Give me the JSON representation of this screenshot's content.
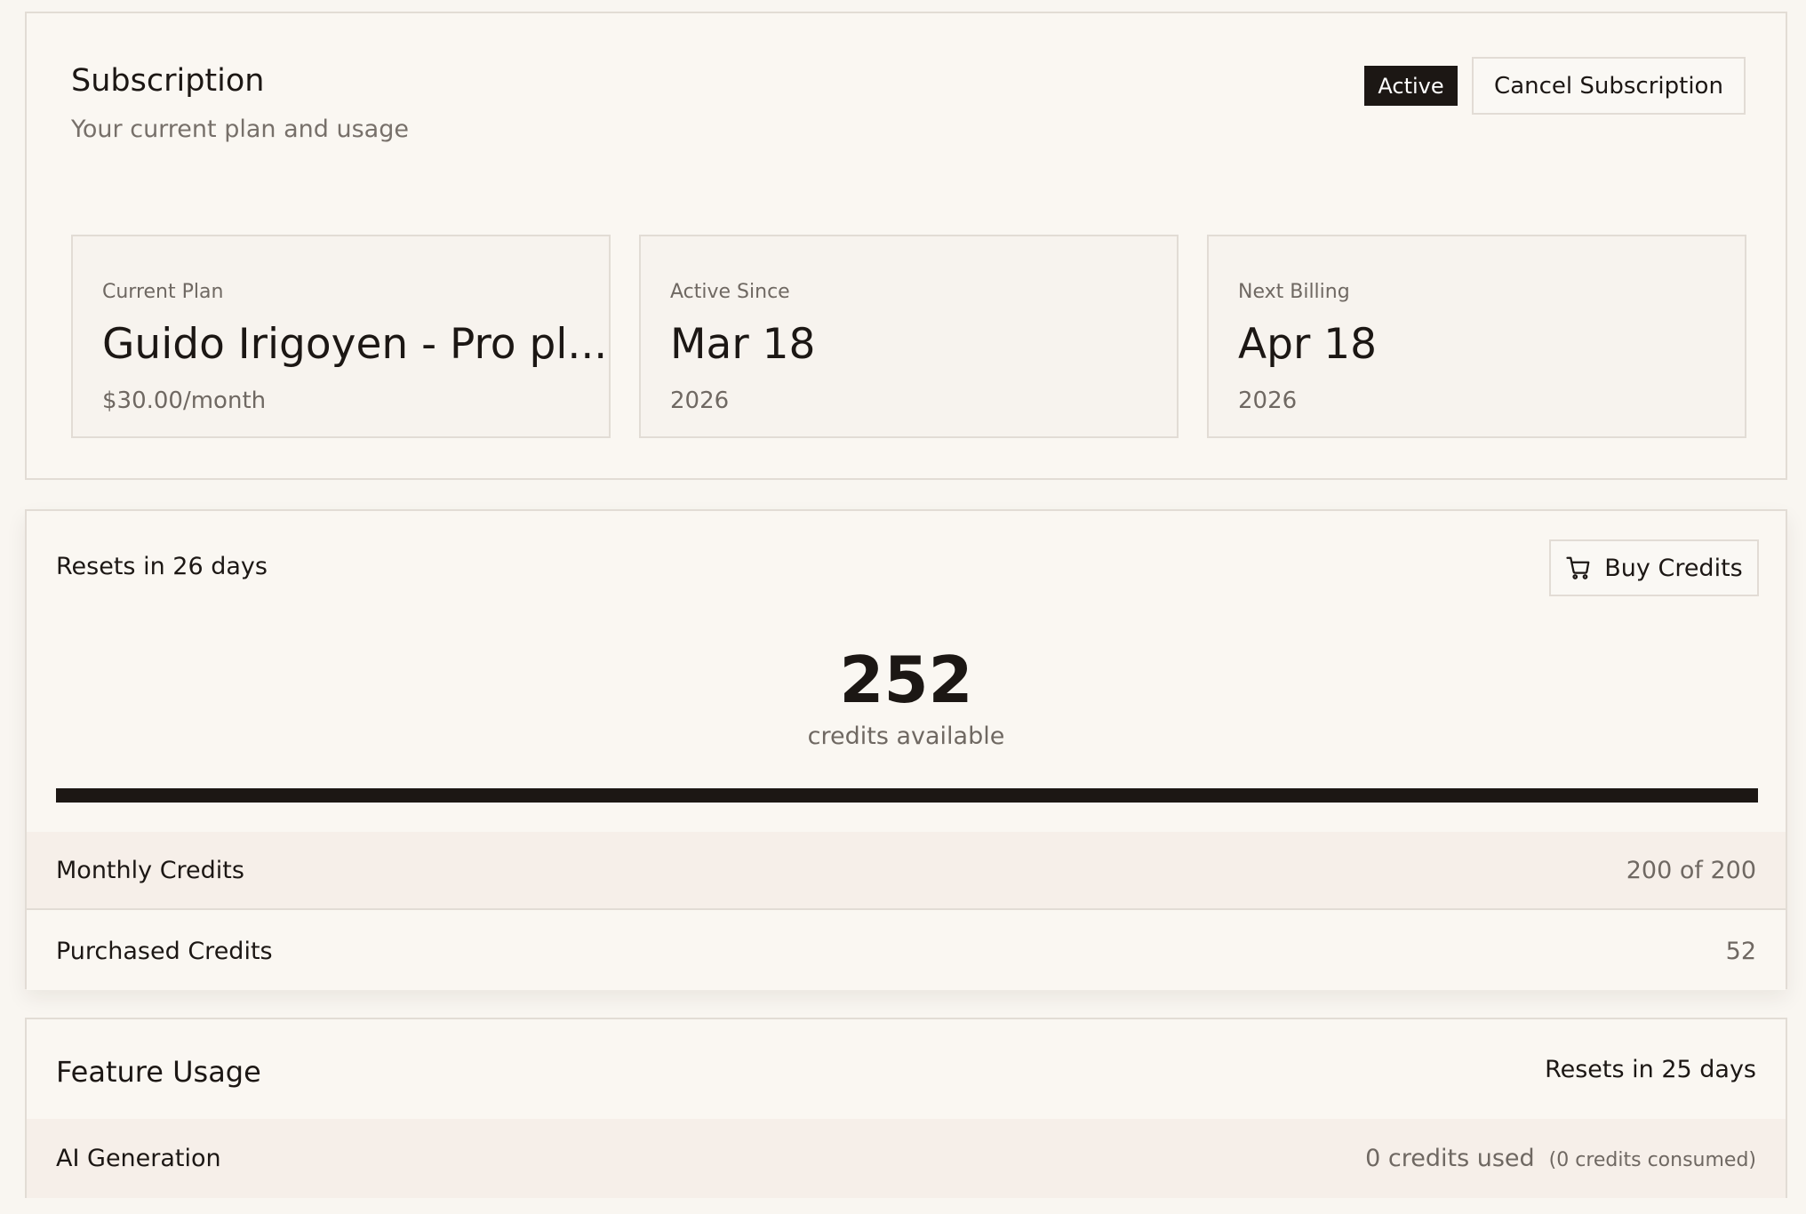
{
  "subscription": {
    "title": "Subscription",
    "subtitle": "Your current plan and usage",
    "status_badge": "Active",
    "cancel_label": "Cancel Subscription",
    "stats": [
      {
        "label": "Current Plan",
        "value": "Guido Irigoyen - Pro pl...",
        "sub": "$30.00/month"
      },
      {
        "label": "Active Since",
        "value": "Mar 18",
        "sub": "2026"
      },
      {
        "label": "Next Billing",
        "value": "Apr 18",
        "sub": "2026"
      }
    ]
  },
  "credits": {
    "resets_text": "Resets in 26 days",
    "buy_label": "Buy Credits",
    "buy_icon": "cart-icon",
    "available_number": "252",
    "available_label": "credits available",
    "progress_fraction": 1.0,
    "rows": [
      {
        "label": "Monthly Credits",
        "value": "200 of 200"
      },
      {
        "label": "Purchased Credits",
        "value": "52"
      }
    ]
  },
  "feature_usage": {
    "title": "Feature Usage",
    "resets_text": "Resets in 25 days",
    "rows": [
      {
        "label": "AI Generation",
        "used": "0 credits used",
        "consumed": "(0 credits consumed)"
      }
    ]
  },
  "colors": {
    "background": "#f9f6f1",
    "text_primary": "#1c1714",
    "text_muted": "#6f6862",
    "border": "#e2dcd5",
    "badge_bg": "#1c1714",
    "row_highlight": "#f6efe9"
  }
}
